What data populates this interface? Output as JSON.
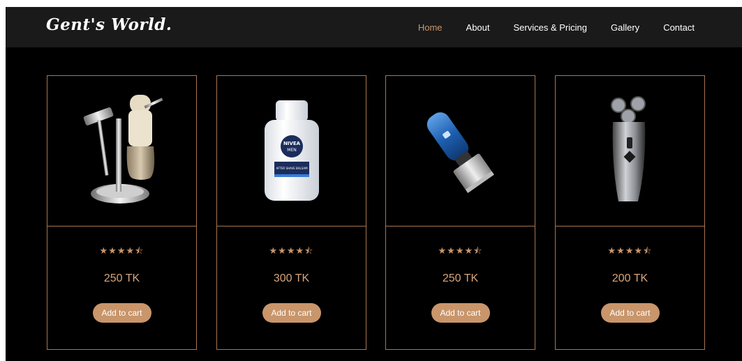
{
  "brand": {
    "logo": "Gent's World."
  },
  "nav": {
    "items": [
      {
        "label": "Home",
        "active": true
      },
      {
        "label": "About"
      },
      {
        "label": "Services & Pricing"
      },
      {
        "label": "Gallery"
      },
      {
        "label": "Contact"
      }
    ]
  },
  "products": [
    {
      "image": "shaving-kit",
      "rating": "★★★★⯪",
      "price": "250 TK",
      "button": "Add to cart"
    },
    {
      "image": "nivea-aftershave-balsam",
      "label_top": "NIVEA",
      "label_bottom": "MEN",
      "label_small": "AFTER SHAVE BALSAM",
      "rating": "★★★★⯪",
      "price": "300 TK",
      "button": "Add to cart"
    },
    {
      "image": "hair-trimmer",
      "rating": "★★★★⯪",
      "price": "250 TK",
      "button": "Add to cart"
    },
    {
      "image": "electric-shaver",
      "rating": "★★★★⯪",
      "price": "200 TK",
      "button": "Add to cart"
    }
  ],
  "colors": {
    "accent": "#c9956a",
    "border": "#a87550",
    "navbar": "#1a1a1a",
    "background": "#000000"
  }
}
